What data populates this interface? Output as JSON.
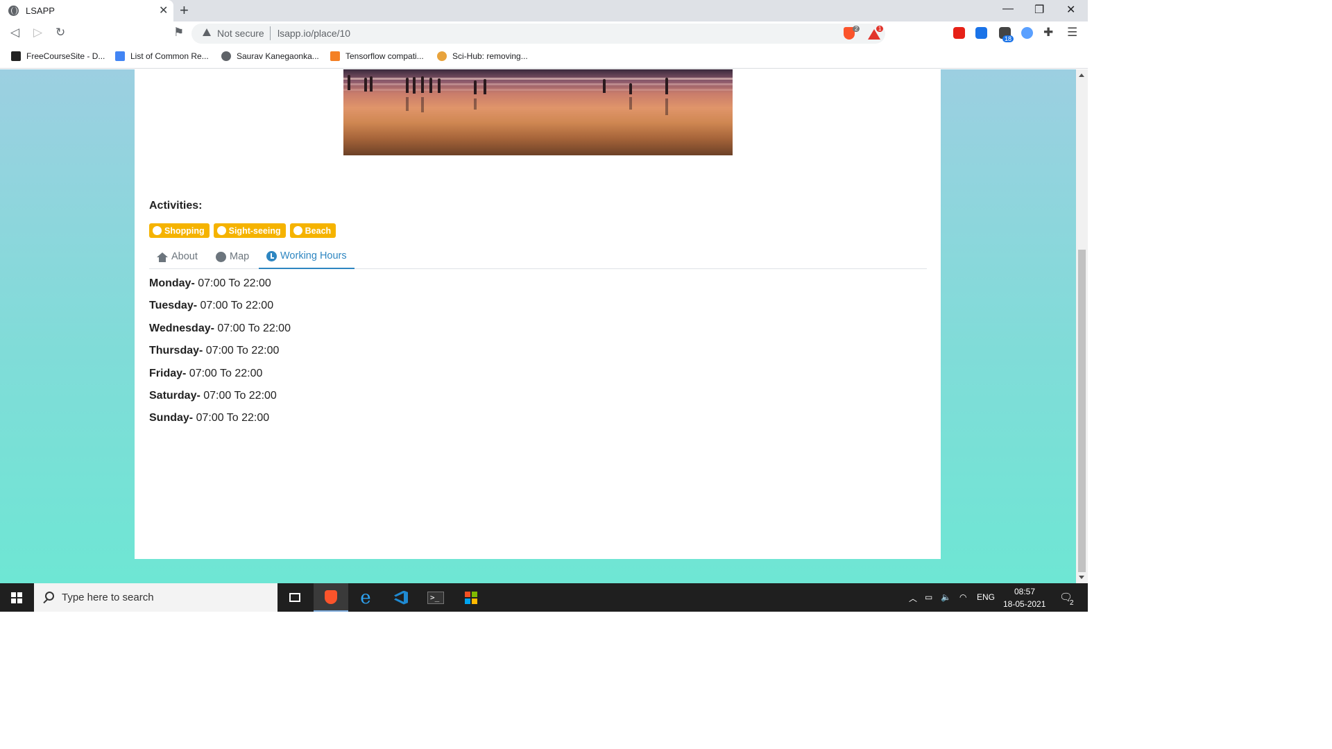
{
  "browser": {
    "tab_title": "LSAPP",
    "not_secure": "Not secure",
    "url": "lsapp.io/place/10",
    "brave_shield_count": "2",
    "rewards_count": "1",
    "extension_badge": "18"
  },
  "bookmarks": [
    {
      "label": "FreeCourseSite - D...",
      "color": "#222222"
    },
    {
      "label": "List of Common Re...",
      "color": "#4285f4"
    },
    {
      "label": "Saurav Kanegaonka...",
      "color": "#5f6368"
    },
    {
      "label": "Tensorflow compati...",
      "color": "#f48024"
    },
    {
      "label": "Sci-Hub: removing...",
      "color": "#e8a33c"
    }
  ],
  "page": {
    "activities_title": "Activities:",
    "activities": [
      "Shopping",
      "Sight-seeing",
      "Beach"
    ],
    "badge_color": "#f5b300",
    "tabs": [
      {
        "label": "About",
        "icon": "home-icon",
        "active": false
      },
      {
        "label": "Map",
        "icon": "globe-icon",
        "active": false
      },
      {
        "label": "Working Hours",
        "icon": "clock-icon",
        "active": true
      }
    ],
    "working_hours": [
      {
        "day": "Monday-",
        "hours": " 07:00 To 22:00"
      },
      {
        "day": "Tuesday-",
        "hours": " 07:00 To 22:00"
      },
      {
        "day": "Wednesday-",
        "hours": " 07:00 To 22:00"
      },
      {
        "day": "Thursday-",
        "hours": " 07:00 To 22:00"
      },
      {
        "day": "Friday-",
        "hours": " 07:00 To 22:00"
      },
      {
        "day": "Saturday-",
        "hours": " 07:00 To 22:00"
      },
      {
        "day": "Sunday-",
        "hours": " 07:00 To 22:00"
      }
    ]
  },
  "taskbar": {
    "search_placeholder": "Type here to search",
    "language": "ENG",
    "time": "08:57",
    "date": "18-05-2021",
    "notification_count": "2"
  }
}
